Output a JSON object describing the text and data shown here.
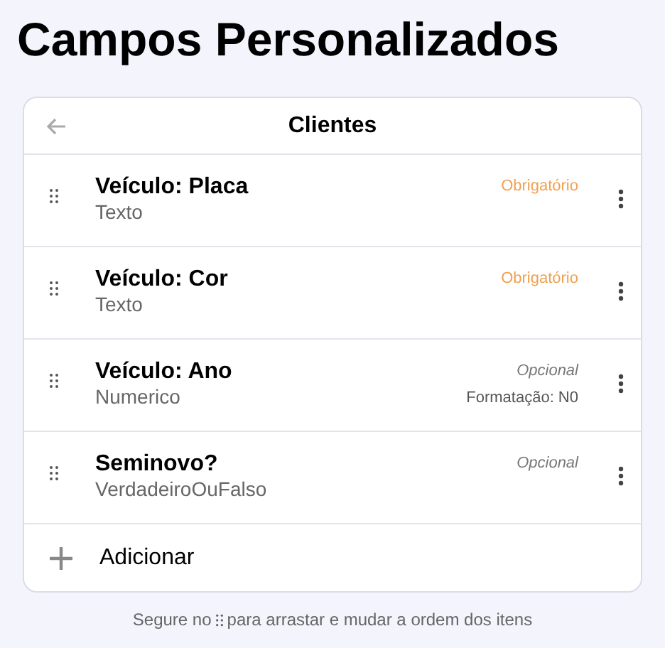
{
  "title": "Campos Personalizados",
  "card": {
    "title": "Clientes"
  },
  "fields": [
    {
      "name": "Veículo: Placa",
      "type": "Texto",
      "required": true,
      "requirement": "Obrigatório"
    },
    {
      "name": "Veículo: Cor",
      "type": "Texto",
      "required": true,
      "requirement": "Obrigatório"
    },
    {
      "name": "Veículo: Ano",
      "type": "Numerico",
      "required": false,
      "requirement": "Opcional",
      "format": "Formatação: N0"
    },
    {
      "name": "Seminovo?",
      "type": "VerdadeiroOuFalso",
      "required": false,
      "requirement": "Opcional"
    }
  ],
  "add_label": "Adicionar",
  "hint": {
    "before": "Segure no",
    "after": "para arrastar e mudar a ordem dos itens"
  }
}
